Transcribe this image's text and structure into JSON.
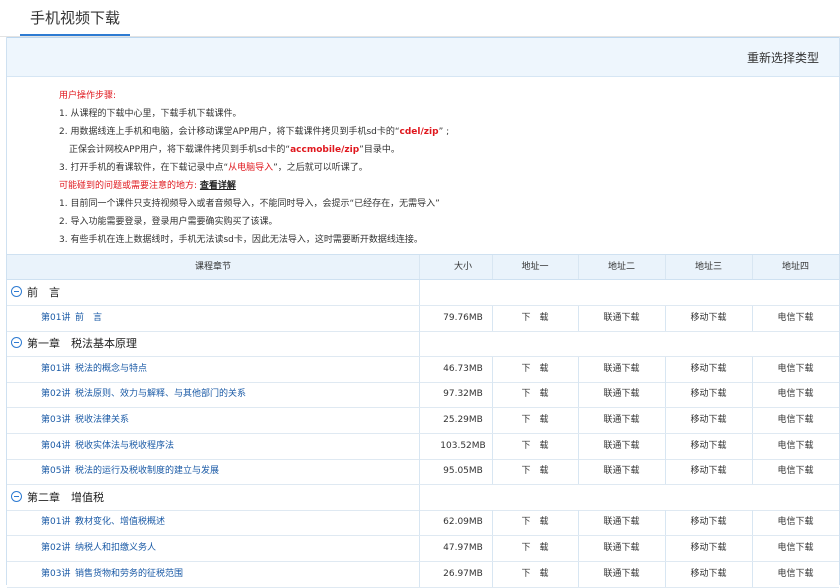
{
  "tab": {
    "label": "手机视频下载"
  },
  "header": {
    "reselect_label": "重新选择类型"
  },
  "notes": {
    "steps_title": "用户操作步骤:",
    "step1": "1. 从课程的下载中心里，下载手机下载课件。",
    "step2_a": "2. 用数据线连上手机和电脑，会计移动课堂APP用户，将下载课件拷贝到手机sd卡的“",
    "step2_path": "cdel/zip",
    "step2_b": "” ;",
    "step2b_a": "正保会计网校APP用户，将下载课件拷贝到手机sd卡的“",
    "step2b_path": "accmobile/zip",
    "step2b_b": "”目录中。",
    "step3_a": "3. 打开手机的看课软件，在下载记录中点“",
    "step3_red": "从电脑导入",
    "step3_b": "”，之后就可以听课了。",
    "issues_title": "可能碰到的问题或需要注意的地方:",
    "issues_link": "查看详解",
    "issue1": "1. 目前同一个课件只支持视频导入或者音频导入，不能同时导入，会提示“已经存在，无需导入”",
    "issue2": "2. 导入功能需要登录，登录用户需要确实购买了该课。",
    "issue3": "3. 有些手机在连上数据线时，手机无法读sd卡，因此无法导入，这时需要断开数据线连接。"
  },
  "table": {
    "headers": [
      "课程章节",
      "大小",
      "地址一",
      "地址二",
      "地址三",
      "地址四"
    ],
    "link_labels": [
      "下　载",
      "联通下载",
      "移动下载",
      "电信下载"
    ],
    "chapters": [
      {
        "title": "前　言",
        "lessons": [
          {
            "num": "第01讲",
            "title": "前　言",
            "size": "79.76MB"
          }
        ]
      },
      {
        "title": "第一章　税法基本原理",
        "lessons": [
          {
            "num": "第01讲",
            "title": "税法的概念与特点",
            "size": "46.73MB"
          },
          {
            "num": "第02讲",
            "title": "税法原则、效力与解释、与其他部门的关系",
            "size": "97.32MB"
          },
          {
            "num": "第03讲",
            "title": "税收法律关系",
            "size": "25.29MB"
          },
          {
            "num": "第04讲",
            "title": "税收实体法与税收程序法",
            "size": "103.52MB"
          },
          {
            "num": "第05讲",
            "title": "税法的运行及税收制度的建立与发展",
            "size": "95.05MB"
          }
        ]
      },
      {
        "title": "第二章　增值税",
        "lessons": [
          {
            "num": "第01讲",
            "title": "教材变化、增值税概述",
            "size": "62.09MB"
          },
          {
            "num": "第02讲",
            "title": "纳税人和扣缴义务人",
            "size": "47.97MB"
          },
          {
            "num": "第03讲",
            "title": "销售货物和劳务的征税范围",
            "size": "26.97MB"
          }
        ]
      }
    ]
  }
}
